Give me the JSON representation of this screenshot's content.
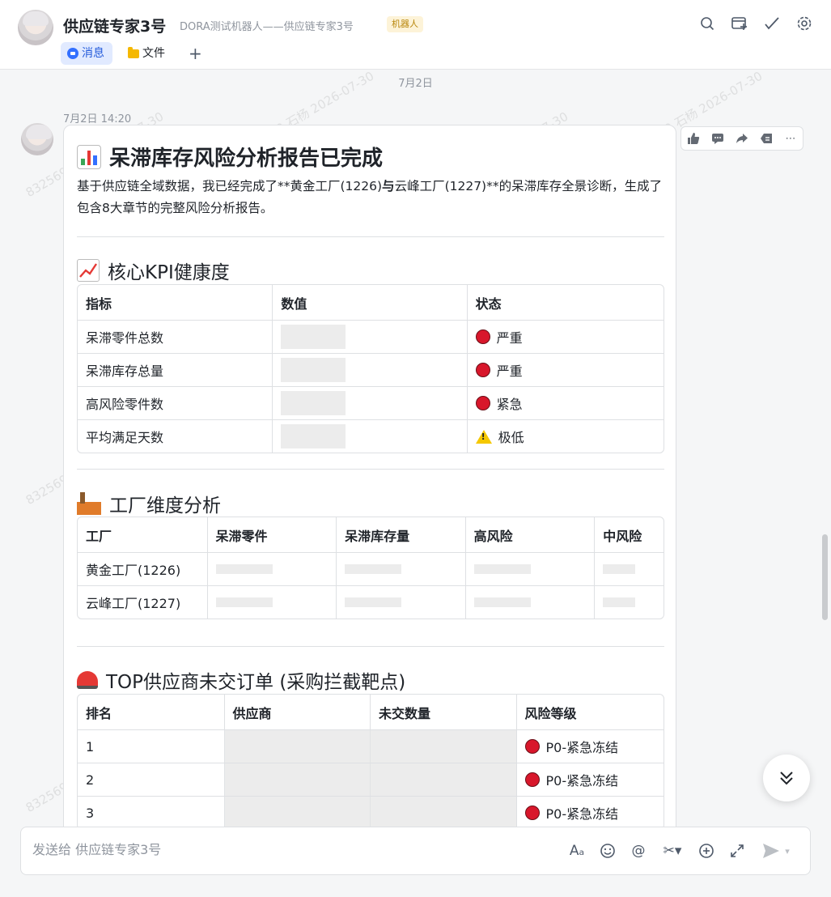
{
  "header": {
    "title": "供应链专家3号",
    "subtitle": "DORA测试机器人——供应链专家3号",
    "badge": "机器人",
    "tabs": [
      {
        "label": "消息"
      },
      {
        "label": "文件"
      }
    ]
  },
  "chat": {
    "date_divider": "7月2日",
    "message_time": "7月2日 14:20"
  },
  "report": {
    "title": "呆滞库存风险分析报告已完成",
    "intro_part1": "基于供应链全域数据，我已经完成了**黄金工厂(1226)",
    "intro_bold": "与",
    "intro_part2": "云峰工厂(1227)**的呆滞库存全景诊断，生成了包含8大章节的完整风险分析报告。",
    "kpi": {
      "heading": "核心KPI健康度",
      "columns": [
        "指标",
        "数值",
        "状态"
      ],
      "rows": [
        {
          "name": "呆滞零件总数",
          "status": "严重",
          "status_icon": "red-circle"
        },
        {
          "name": "呆滞库存总量",
          "status": "严重",
          "status_icon": "red-circle"
        },
        {
          "name": "高风险零件数",
          "status": "紧急",
          "status_icon": "red-circle"
        },
        {
          "name": "平均满足天数",
          "status": "极低",
          "status_icon": "warning"
        }
      ]
    },
    "factory": {
      "heading": "工厂维度分析",
      "columns": [
        "工厂",
        "呆滞零件",
        "呆滞库存量",
        "高风险",
        "中风险"
      ],
      "rows": [
        {
          "name": "黄金工厂(1226)"
        },
        {
          "name": "云峰工厂(1227)"
        }
      ]
    },
    "suppliers": {
      "heading": "TOP供应商未交订单 (采购拦截靶点)",
      "columns": [
        "排名",
        "供应商",
        "未交数量",
        "风险等级"
      ],
      "rows": [
        {
          "rank": "1",
          "risk": "P0-紧急冻结"
        },
        {
          "rank": "2",
          "risk": "P0-紧急冻结"
        },
        {
          "rank": "3",
          "risk": "P0-紧急冻结"
        }
      ]
    }
  },
  "composer": {
    "placeholder": "发送给 供应链专家3号"
  },
  "watermark": "8325690 石杨 2026-07-30",
  "colors": {
    "accent": "#3370ff",
    "danger": "#d8172b",
    "warning": "#f5c800"
  }
}
